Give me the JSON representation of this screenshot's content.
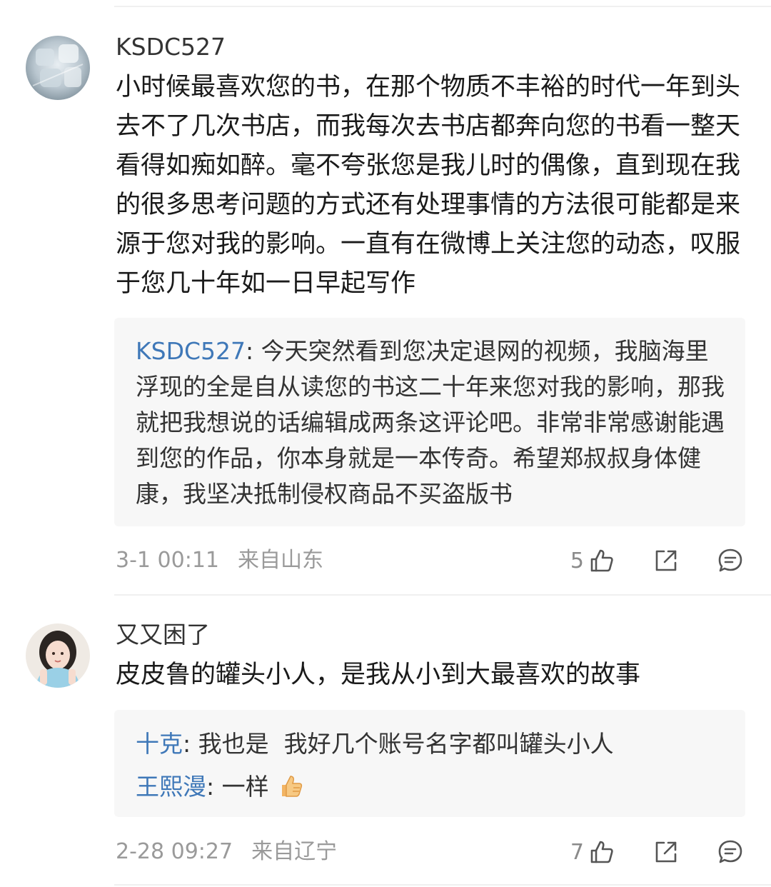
{
  "comments": [
    {
      "username": "KSDC527",
      "text": "小时候最喜欢您的书，在那个物质不丰裕的时代一年到头去不了几次书店，而我每次去书店都奔向您的书看一整天看得如痴如醉。毫不夸张您是我儿时的偶像，直到现在我的很多思考问题的方式还有处理事情的方法很可能都是来源于您对我的影响。一直有在微博上关注您的动态，叹服于您几十年如一日早起写作",
      "replies": [
        {
          "author": "KSDC527",
          "sep": ": ",
          "text": "今天突然看到您决定退网的视频，我脑海里浮现的全是自从读您的书这二十年来您对我的影响，那我就把我想说的话编辑成两条这评论吧。非常非常感谢能遇到您的作品，你本身就是一本传奇。希望郑叔叔身体健康，我坚决抵制侵权商品不买盗版书"
        }
      ],
      "time": "3-1 00:11",
      "location": "来自山东",
      "likes": "5"
    },
    {
      "username": "又又困了",
      "text": "皮皮鲁的罐头小人，是我从小到大最喜欢的故事",
      "replies": [
        {
          "author": "十克",
          "sep": ": ",
          "text": "我也是  我好几个账号名字都叫罐头小人"
        },
        {
          "author": "王熙漫",
          "sep": ": ",
          "text": "一样"
        }
      ],
      "time": "2-28 09:27",
      "location": "来自辽宁",
      "likes": "7"
    }
  ],
  "colors": {
    "link_blue": "#3f78b8",
    "meta_gray": "#9a9a9a",
    "reply_bg": "#f7f7f7"
  },
  "icons": [
    "like-icon",
    "share-icon",
    "comment-icon",
    "thumbs-up-emoji"
  ]
}
